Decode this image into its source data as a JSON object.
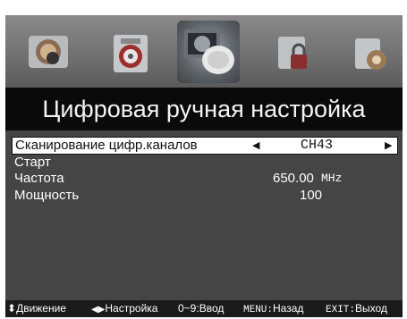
{
  "menu_icons": [
    {
      "name": "picture-icon"
    },
    {
      "name": "sound-icon"
    },
    {
      "name": "channel-icon"
    },
    {
      "name": "lock-icon"
    },
    {
      "name": "setup-icon"
    }
  ],
  "page": {
    "title": "Цифровая ручная настройка"
  },
  "rows": {
    "scan": {
      "label": "Сканирование цифр.каналов",
      "value": "CH43",
      "left_arrow": "◀",
      "right_arrow": "▶"
    },
    "start": {
      "label": "Старт"
    },
    "frequency": {
      "label": "Частота",
      "value": "650.00",
      "unit": "MHz"
    },
    "power": {
      "label": "Мощность",
      "value": "100"
    }
  },
  "footer": {
    "move": {
      "icon": "⬍",
      "label": "Движение"
    },
    "adjust": {
      "icon": "◀▶",
      "label": "Настройка"
    },
    "input": {
      "key": "0~9:",
      "label": "Ввод"
    },
    "menu": {
      "key": "MENU:",
      "label": "Назад"
    },
    "exit": {
      "key": "EXIT:",
      "label": "Выход"
    }
  },
  "colors": {
    "accent": "#ffffff",
    "background": "#454545",
    "title_bg": "#0a0a0a"
  }
}
